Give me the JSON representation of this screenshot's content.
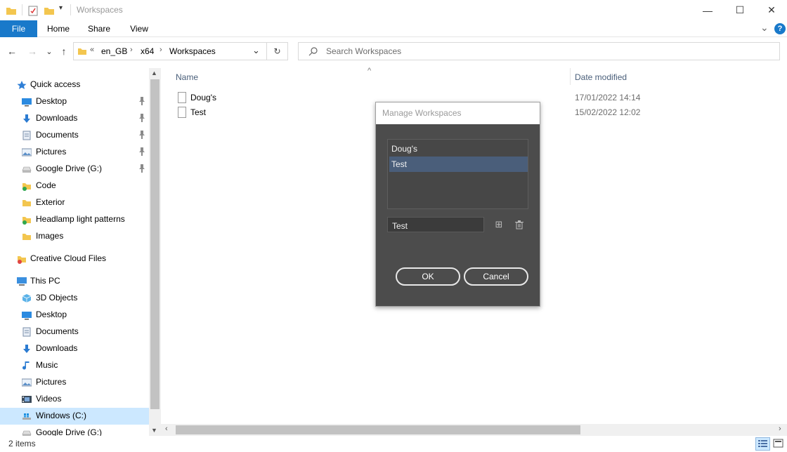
{
  "window": {
    "title": "Workspaces",
    "minimize_glyph": "—",
    "maximize_glyph": "☐",
    "close_glyph": "✕"
  },
  "ribbon": {
    "tabs": [
      "File",
      "Home",
      "Share",
      "View"
    ],
    "expand_glyph": "⌄",
    "help_glyph": "?"
  },
  "address": {
    "overflow": "«",
    "breadcrumbs": [
      "en_GB",
      "x64",
      "Workspaces"
    ],
    "separator": "›",
    "dropdown_glyph": "⌄",
    "refresh_glyph": "↻",
    "search_placeholder": "Search Workspaces"
  },
  "nav_buttons": {
    "back": "←",
    "forward": "→",
    "recent": "⌄",
    "up": "↑"
  },
  "navpane": {
    "items": [
      {
        "label": "Quick access",
        "icon": "star-icon",
        "level": 0,
        "pinned": false
      },
      {
        "label": "Desktop",
        "icon": "desktop-icon",
        "level": 1,
        "pinned": true
      },
      {
        "label": "Downloads",
        "icon": "download-icon",
        "level": 1,
        "pinned": true
      },
      {
        "label": "Documents",
        "icon": "documents-icon",
        "level": 1,
        "pinned": true
      },
      {
        "label": "Pictures",
        "icon": "pictures-icon",
        "level": 1,
        "pinned": true
      },
      {
        "label": "Google Drive (G:)",
        "icon": "drive-icon",
        "level": 1,
        "pinned": true
      },
      {
        "label": "Code",
        "icon": "synced-folder-icon",
        "level": 1,
        "pinned": false
      },
      {
        "label": "Exterior",
        "icon": "folder-icon",
        "level": 1,
        "pinned": false
      },
      {
        "label": "Headlamp light patterns",
        "icon": "synced-folder-icon",
        "level": 1,
        "pinned": false
      },
      {
        "label": "Images",
        "icon": "folder-icon",
        "level": 1,
        "pinned": false
      },
      {
        "label": "Creative Cloud Files",
        "icon": "creative-cloud-folder-icon",
        "level": 0,
        "pinned": false
      },
      {
        "label": "This PC",
        "icon": "computer-icon",
        "level": 0,
        "pinned": false
      },
      {
        "label": "3D Objects",
        "icon": "cube-icon",
        "level": 1,
        "pinned": false
      },
      {
        "label": "Desktop",
        "icon": "desktop-icon",
        "level": 1,
        "pinned": false
      },
      {
        "label": "Documents",
        "icon": "documents-icon",
        "level": 1,
        "pinned": false
      },
      {
        "label": "Downloads",
        "icon": "download-icon",
        "level": 1,
        "pinned": false
      },
      {
        "label": "Music",
        "icon": "music-icon",
        "level": 1,
        "pinned": false
      },
      {
        "label": "Pictures",
        "icon": "pictures-icon",
        "level": 1,
        "pinned": false
      },
      {
        "label": "Videos",
        "icon": "videos-icon",
        "level": 1,
        "pinned": false
      },
      {
        "label": "Windows (C:)",
        "icon": "windows-drive-icon",
        "level": 1,
        "pinned": false,
        "selected": true
      },
      {
        "label": "Google Drive (G:)",
        "icon": "drive-icon",
        "level": 1,
        "pinned": false
      }
    ],
    "pin_glyph": "📌"
  },
  "content": {
    "columns": {
      "name": "Name",
      "date": "Date modified"
    },
    "sort_glyph": "^",
    "files": [
      {
        "name": "Doug's",
        "date": "17/01/2022 14:14"
      },
      {
        "name": "Test",
        "date": "15/02/2022 12:02"
      }
    ]
  },
  "status": {
    "count": "2 items"
  },
  "dialog": {
    "title": "Manage Workspaces",
    "workspaces": [
      "Doug's",
      "Test"
    ],
    "selected_index": 1,
    "name_value": "Test",
    "add_glyph": "⊞",
    "delete_glyph": "🗑",
    "ok_label": "OK",
    "cancel_label": "Cancel"
  },
  "colors": {
    "file_tab": "#1979ca",
    "selection": "#cce8ff",
    "dialog_bg": "#4c4c4c",
    "dialog_selection": "#4a5e7a"
  }
}
